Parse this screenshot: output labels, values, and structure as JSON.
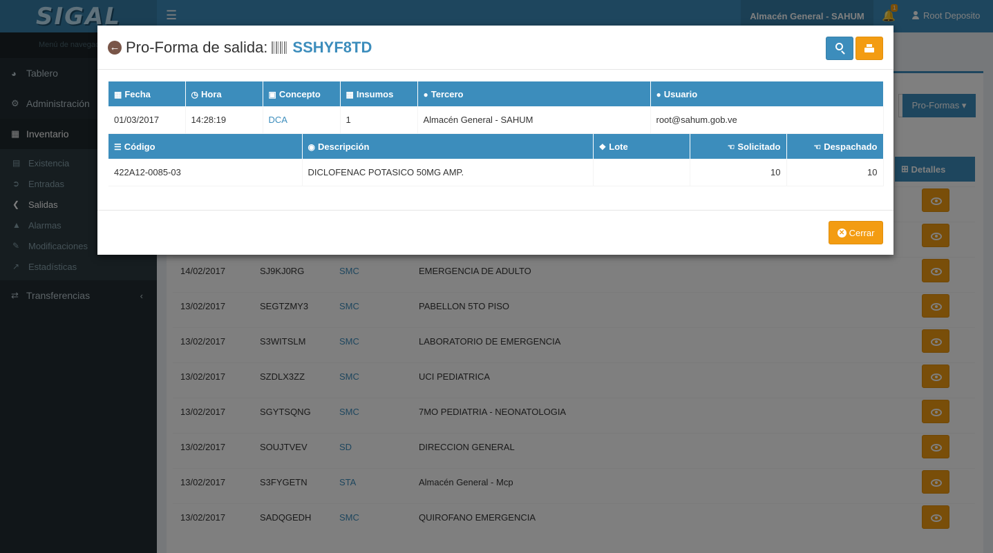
{
  "app": {
    "logo": "SIGAL"
  },
  "topbar": {
    "warehouse": "Almacén General - SAHUM",
    "notifications": "1",
    "user": "Root Deposito"
  },
  "sidebar": {
    "header": "Menú de navegación",
    "items": [
      {
        "label": "Tablero",
        "icon": "dashboard-icon"
      },
      {
        "label": "Administración",
        "icon": "gear-icon"
      },
      {
        "label": "Inventario",
        "icon": "table-icon"
      },
      {
        "label": "Transferencias",
        "icon": "exchange-icon"
      }
    ],
    "submenu": [
      {
        "label": "Existencia",
        "icon": "bars-icon"
      },
      {
        "label": "Entradas",
        "icon": "arrow-right-circle-icon"
      },
      {
        "label": "Salidas",
        "icon": "arrow-left-circle-icon"
      },
      {
        "label": "Alarmas",
        "icon": "bell-icon"
      },
      {
        "label": "Modificaciones",
        "icon": "edit-icon"
      },
      {
        "label": "Estadísticas",
        "icon": "line-chart-icon"
      }
    ]
  },
  "background": {
    "proformas_button": "Pro-Formas",
    "detalles_header": "Detalles",
    "rows": [
      {
        "date": "14/02/2017",
        "code": "SJ9KJ0RG",
        "concept": "SMC",
        "destination": "EMERGENCIA DE ADULTO"
      },
      {
        "date": "13/02/2017",
        "code": "SEGTZMY3",
        "concept": "SMC",
        "destination": "PABELLON 5TO PISO"
      },
      {
        "date": "13/02/2017",
        "code": "S3WITSLM",
        "concept": "SMC",
        "destination": "LABORATORIO DE EMERGENCIA"
      },
      {
        "date": "13/02/2017",
        "code": "SZDLX3ZZ",
        "concept": "SMC",
        "destination": "UCI PEDIATRICA"
      },
      {
        "date": "13/02/2017",
        "code": "SGYTSQNG",
        "concept": "SMC",
        "destination": "7MO PEDIATRIA - NEONATOLOGIA"
      },
      {
        "date": "13/02/2017",
        "code": "SOUJTVEV",
        "concept": "SD",
        "destination": "DIRECCION GENERAL"
      },
      {
        "date": "13/02/2017",
        "code": "S3FYGETN",
        "concept": "STA",
        "destination": "Almacén General - Mcp"
      },
      {
        "date": "13/02/2017",
        "code": "SADQGEDH",
        "concept": "SMC",
        "destination": "QUIROFANO EMERGENCIA"
      }
    ]
  },
  "modal": {
    "title": "Pro-Forma de salida:",
    "code": "SSHYF8TD",
    "info_headers": {
      "fecha": "Fecha",
      "hora": "Hora",
      "concepto": "Concepto",
      "insumos": "Insumos",
      "tercero": "Tercero",
      "usuario": "Usuario"
    },
    "info": {
      "fecha": "01/03/2017",
      "hora": "14:28:19",
      "concepto": "DCA",
      "insumos": "1",
      "tercero": "Almacén General - SAHUM",
      "usuario": "root@sahum.gob.ve"
    },
    "item_headers": {
      "codigo": "Código",
      "descripcion": "Descripción",
      "lote": "Lote",
      "solicitado": "Solicitado",
      "despachado": "Despachado"
    },
    "items": [
      {
        "codigo": "422A12-0085-03",
        "descripcion": "DICLOFENAC POTASICO 50MG AMP.",
        "lote": "",
        "solicitado": "10",
        "despachado": "10"
      }
    ],
    "close_label": "Cerrar"
  },
  "colors": {
    "primary": "#3c8dbc",
    "warning": "#f39c12",
    "sidebar": "#222d32"
  }
}
